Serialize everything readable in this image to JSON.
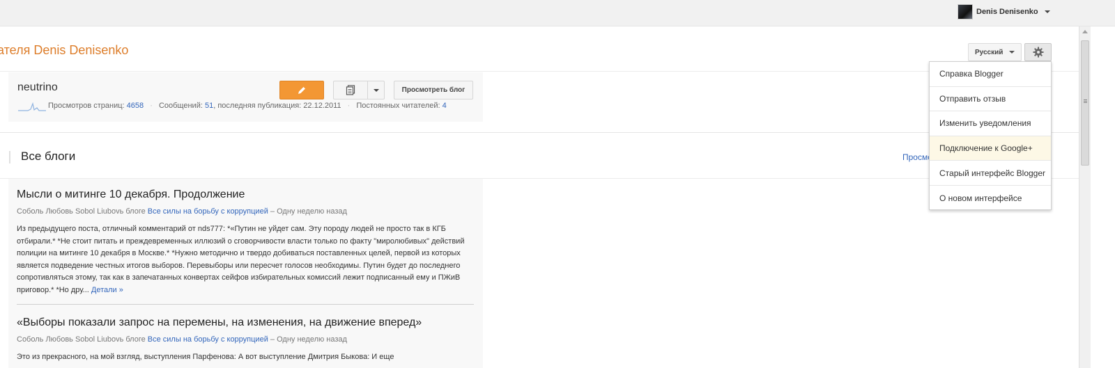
{
  "topbar": {
    "user_name": "Denis Denisenko"
  },
  "header": {
    "title": "ателя Denis Denisenko"
  },
  "controls": {
    "language": "Русский"
  },
  "settings_menu": {
    "items": [
      {
        "label": "Справка Blogger"
      },
      {
        "label": "Отправить отзыв"
      },
      {
        "label": "Изменить уведомления"
      },
      {
        "label": "Подключение к Google+"
      },
      {
        "label": "Старый интерфейс Blogger"
      },
      {
        "label": "О новом интерфейсе"
      }
    ]
  },
  "blog": {
    "name": "neutrino",
    "pageviews_label": "Просмотров страниц:",
    "pageviews": "4658",
    "posts_label": "Сообщений:",
    "posts": "51",
    "last_post_label": ", последняя публикация: 22.12.2011",
    "followers_label": "Постоянных читателей:",
    "followers": "4",
    "view_blog_label": "Просмотреть блог"
  },
  "section": {
    "title": "Все блоги",
    "link_label": "Просмотреть"
  },
  "posts": [
    {
      "title": "Мысли о митинге 10 декабря. Продолжение",
      "author": "Соболь Любовь Sobol Liubovь блоге",
      "blog": "Все силы на борьбу с коррупцией",
      "time": "– Одну неделю назад",
      "body": "Из предыдущего поста, отличный комментарий от nds777: *«Путин не уйдет сам. Эту породу людей не просто так в КГБ отбирали.* *Не стоит питать и преждевременных иллюзий о сговорчивости власти только по факту \"миролюбивых\" действий полиции на митинге 10 декабря в Москве.* *Нужно методично и твердо добиваться поставленных целей, первой из которых является подведение честных итогов выборов. Перевыборы или пересчет голосов необходимы. Путин будет до последнего сопротивляться этому, так как в запечатанных конвертах сейфов избирательных комиссий лежит подписанный ему и ПЖиВ приговор.* *Но дру...",
      "more": "Детали »"
    },
    {
      "title": "«Выборы показали запрос на перемены, на изменения, на движение вперед»",
      "author": "Соболь Любовь Sobol Liubovь блоге",
      "blog": "Все силы на борьбу с коррупцией",
      "time": "– Одну неделю назад",
      "body": "Это из прекрасного, на мой взгляд, выступления Парфенова: А вот выступление Дмитрия Быкова: И еще"
    }
  ]
}
